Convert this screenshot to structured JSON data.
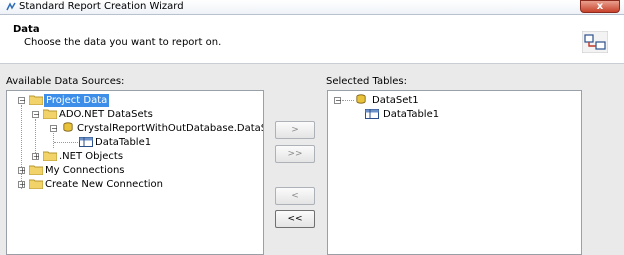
{
  "window": {
    "title": "Standard Report Creation Wizard",
    "close_label": "x"
  },
  "header": {
    "title": "Data",
    "description": "Choose the data you want to report on."
  },
  "available": {
    "label": "Available Data Sources:",
    "nodes": [
      {
        "label": "Project Data",
        "selected": true
      },
      {
        "label": "ADO.NET DataSets"
      },
      {
        "label": "CrystalReportWithOutDatabase.DataSe"
      },
      {
        "label": "DataTable1"
      },
      {
        "label": ".NET Objects"
      },
      {
        "label": "My Connections"
      },
      {
        "label": "Create New Connection"
      }
    ]
  },
  "selected": {
    "label": "Selected Tables:",
    "nodes": [
      {
        "label": "DataSet1"
      },
      {
        "label": "DataTable1"
      }
    ]
  },
  "buttons": {
    "add_one": ">",
    "add_all": ">>",
    "remove_one": "<",
    "remove_all": "<<"
  },
  "icons": {
    "app": "wizard-app-icon",
    "header": "table-link-icon",
    "folder": "folder-icon",
    "dataset": "dataset-icon",
    "table": "datatable-icon"
  }
}
